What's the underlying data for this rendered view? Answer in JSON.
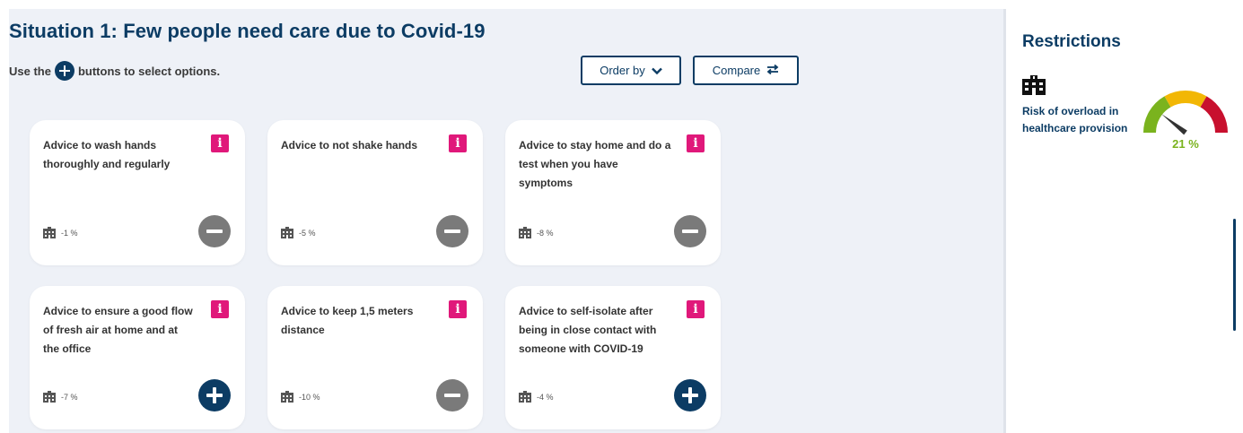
{
  "header": {
    "title": "Situation 1: Few people need care due to Covid-19",
    "instruction_before": "Use the",
    "instruction_after": "buttons to select options.",
    "instruction_icon": "plus-circle-icon"
  },
  "toolbar": {
    "order_label": "Order by",
    "order_icon": "chevron-down-icon",
    "compare_label": "Compare",
    "compare_icon": "swap-arrows-icon"
  },
  "cards": [
    {
      "text": "Advice to wash hands thoroughly and regularly",
      "info": "i",
      "impact": "-1 %",
      "action": "minus"
    },
    {
      "text": "Advice to not shake hands",
      "info": "i",
      "impact": "-5 %",
      "action": "minus"
    },
    {
      "text": "Advice to stay home and do a test when you have symptoms",
      "info": "i",
      "impact": "-8 %",
      "action": "minus"
    },
    {
      "text": "Advice to ensure a good flow of fresh air at home and at the office",
      "info": "i",
      "impact": "-7 %",
      "action": "plus"
    },
    {
      "text": "Advice to keep 1,5 meters distance",
      "info": "i",
      "impact": "-10 %",
      "action": "minus"
    },
    {
      "text": "Advice to self-isolate after being in close contact with someone with COVID-19",
      "info": "i",
      "impact": "-4 %",
      "action": "plus"
    }
  ],
  "sidebar": {
    "title": "Restrictions",
    "metric_icon": "hospital-icon",
    "metric_label": "Risk of overload in healthcare provision",
    "gauge_value": "21 %",
    "gauge_fraction": 0.21
  },
  "colors": {
    "primary": "#0c3c64",
    "info_badge": "#e0187a",
    "minus_button": "#7a7a7a",
    "plus_button": "#0c3c64",
    "gauge_green": "#7ab31e",
    "gauge_yellow": "#f2b705",
    "gauge_red": "#c8102e",
    "background": "#eef1f7"
  }
}
